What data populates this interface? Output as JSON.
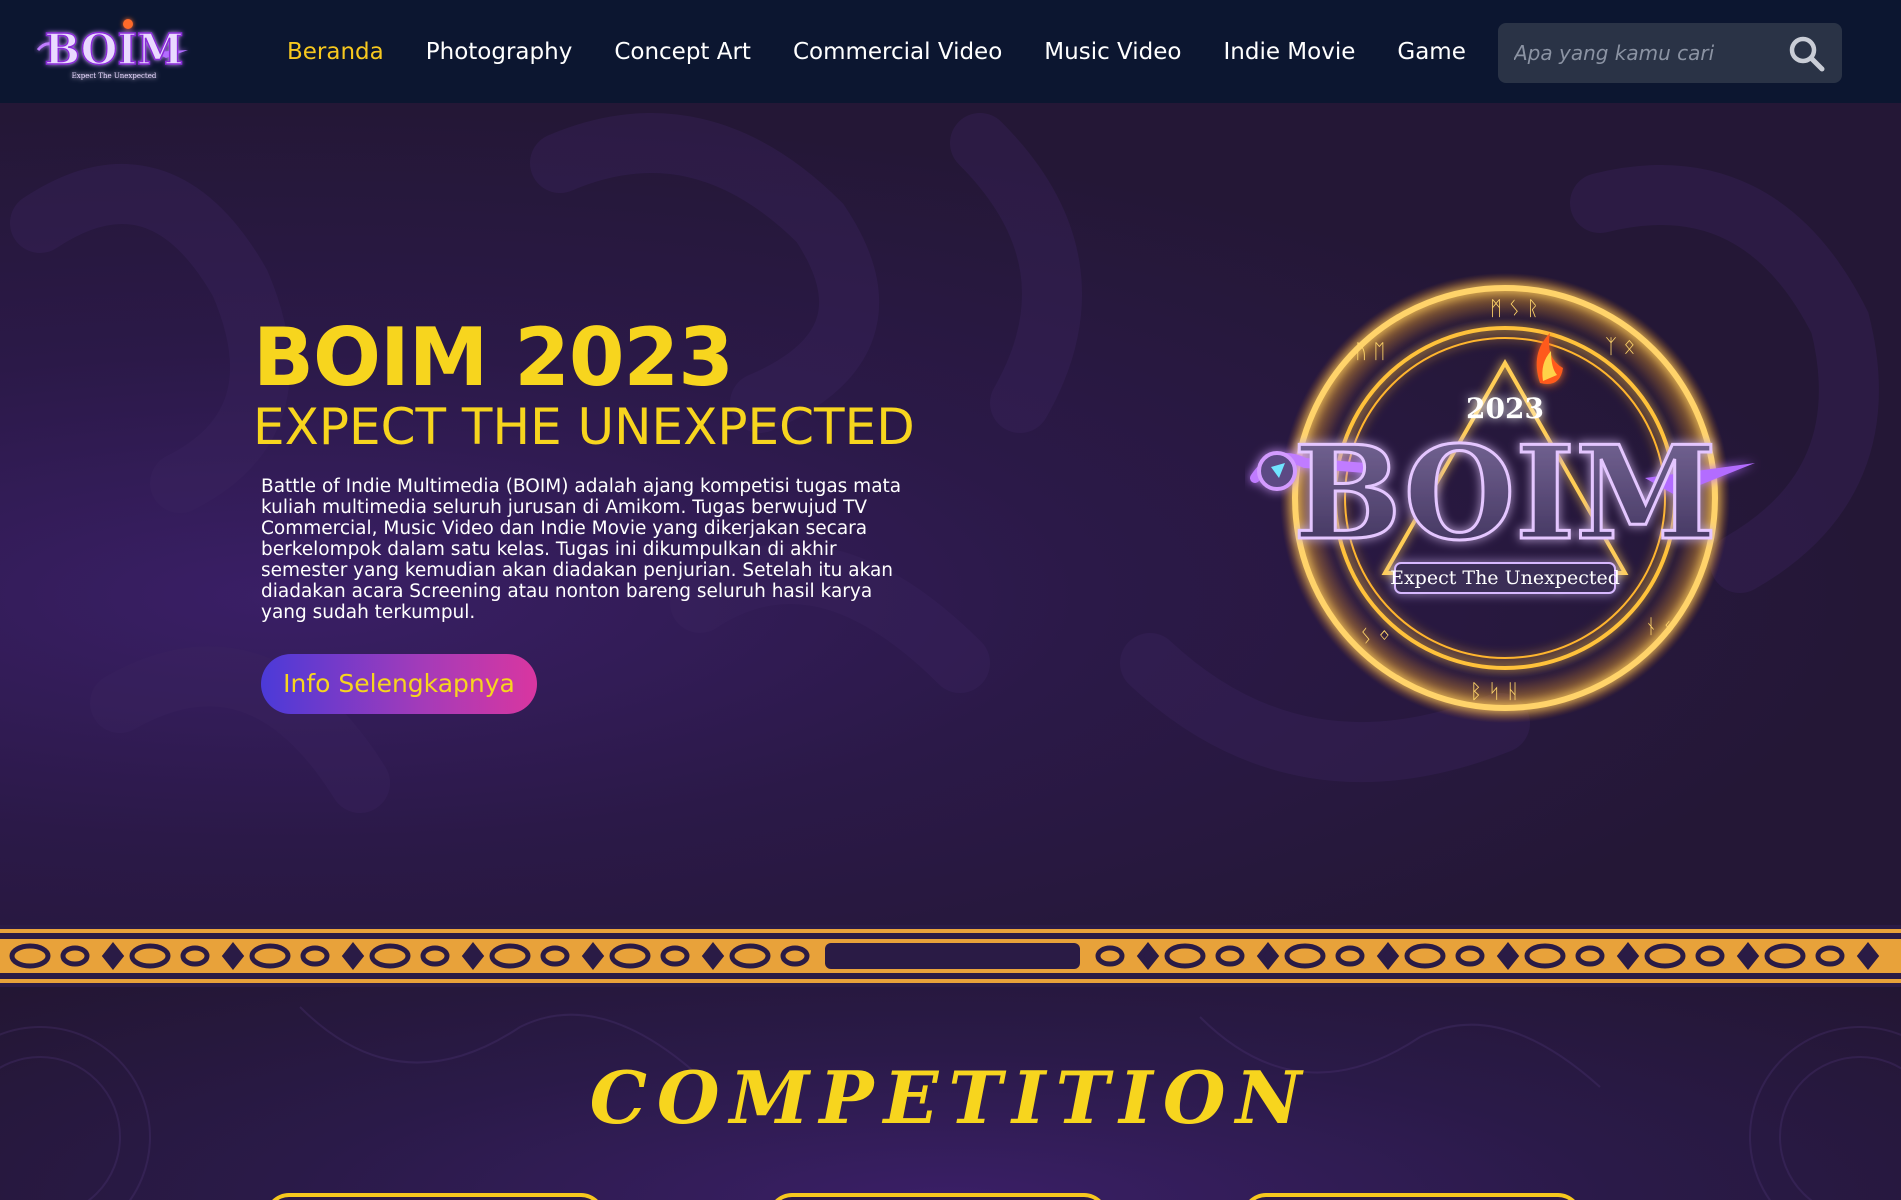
{
  "logo": {
    "text": "BOIM",
    "tagline": "Expect The Unexpected"
  },
  "nav": {
    "items": [
      {
        "label": "Beranda",
        "active": true
      },
      {
        "label": "Photography",
        "active": false
      },
      {
        "label": "Concept Art",
        "active": false
      },
      {
        "label": "Commercial Video",
        "active": false
      },
      {
        "label": "Music Video",
        "active": false
      },
      {
        "label": "Indie Movie",
        "active": false
      },
      {
        "label": "Game",
        "active": false
      }
    ],
    "search": {
      "placeholder": "Apa yang kamu cari",
      "icon": "search-icon"
    }
  },
  "hero": {
    "title": "BOIM 2023",
    "subtitle": "EXPECT THE UNEXPECTED",
    "description": "Battle of Indie Multimedia (BOIM) adalah ajang kompetisi tugas mata kuliah multimedia seluruh jurusan di Amikom. Tugas berwujud TV Commercial, Music Video dan Indie Movie yang dikerjakan secara berkelompok dalam satu kelas. Tugas ini dikumpulkan di akhir semester yang kemudian akan diadakan penjurian. Setelah itu akan diadakan acara Screening atau nonton bareng seluruh hasil karya yang sudah terkumpul.",
    "button_label": "Info Selengkapnya",
    "emblem": {
      "year": "2023",
      "name": "BOIM",
      "tagline": "Expect The Unexpected"
    }
  },
  "competition": {
    "title": "COMPETITION"
  },
  "colors": {
    "navbar_bg": "#0c1630",
    "accent_yellow": "#f7d51e",
    "hero_bg": "#241736",
    "band_gold": "#e8a23a"
  }
}
